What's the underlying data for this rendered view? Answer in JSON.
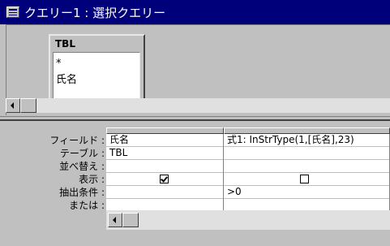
{
  "window": {
    "title": "クエリー1 : 選択クエリー",
    "icon": "query-icon"
  },
  "table": {
    "name": "TBL",
    "fields": [
      "*",
      "氏名"
    ]
  },
  "grid": {
    "row_labels": [
      "フィールド :",
      "テーブル :",
      "並べ替え :",
      "表示 :",
      "抽出条件 :",
      "または :"
    ],
    "columns": [
      {
        "field": "氏名",
        "table": "TBL",
        "sort": "",
        "show": true,
        "criteria": "",
        "or": ""
      },
      {
        "field": "式1: InStrType(1,[氏名],23)",
        "table": "",
        "sort": "",
        "show": false,
        "criteria": ">0",
        "or": ""
      }
    ]
  }
}
